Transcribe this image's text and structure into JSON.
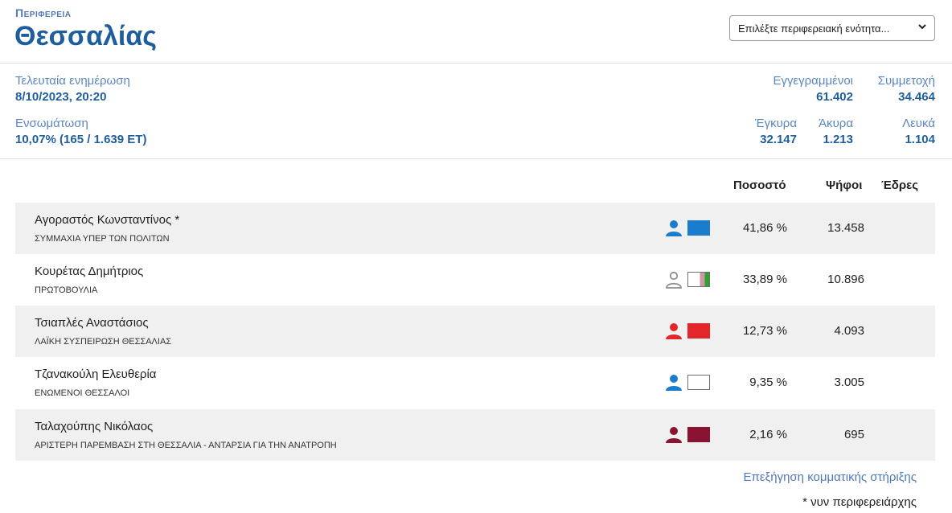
{
  "header": {
    "kicker": "Περιφερεια",
    "title": "Θεσσαλίας",
    "select_label": "Επιλέξτε περιφερειακή ενότητα..."
  },
  "stats": {
    "last_update_label": "Τελευταία ενημέρωση",
    "last_update_value": "8/10/2023, 20:20",
    "integration_label": "Ενσωμάτωση",
    "integration_value": "10,07% (165 / 1.639 ΕΤ)",
    "registered_label": "Εγγεγραμμένοι",
    "registered_value": "61.402",
    "turnout_label": "Συμμετοχή",
    "turnout_value": "34.464",
    "valid_label": "Έγκυρα",
    "valid_value": "32.147",
    "invalid_label": "Άκυρα",
    "invalid_value": "1.213",
    "blank_label": "Λευκά",
    "blank_value": "1.104"
  },
  "table": {
    "headers": {
      "percent": "Ποσοστό",
      "votes": "Ψήφοι",
      "seats": "Έδρες"
    },
    "rows": [
      {
        "name": "Αγοραστός Κωνσταντίνος *",
        "party": "ΣΥΜΜΑΧΙΑ ΥΠΕΡ ΤΩΝ ΠΟΛΙΤΩΝ",
        "percent": "41,86 %",
        "votes": "13.458",
        "color": "#1a7ccc",
        "icon": "person-filled-icon"
      },
      {
        "name": "Κουρέτας Δημήτριος",
        "party": "ΠΡΩΤΟΒΟΥΛΙΑ",
        "percent": "33,89 %",
        "votes": "10.896",
        "color": "#8f8f8f",
        "icon": "person-outline-icon"
      },
      {
        "name": "Τσιαπλές Αναστάσιος",
        "party": "ΛΑΪΚΗ ΣΥΣΠΕΙΡΩΣΗ ΘΕΣΣΑΛΙΑΣ",
        "percent": "12,73 %",
        "votes": "4.093",
        "color": "#e3262a",
        "icon": "person-filled-icon"
      },
      {
        "name": "Τζανακούλη Ελευθερία",
        "party": "ΕΝΩΜΕΝΟΙ ΘΕΣΣΑΛΟΙ",
        "percent": "9,35 %",
        "votes": "3.005",
        "color": "#1a7ccc",
        "icon": "person-filled-icon"
      },
      {
        "name": "Ταλαχούπης Νικόλαος",
        "party": "ΑΡΙΣΤΕΡΗ ΠΑΡΕΜΒΑΣΗ ΣΤΗ ΘΕΣΣΑΛΙΑ - ΑΝΤΑΡΣΙΑ ΓΙΑ ΤΗΝ ΑΝΑΤΡΟΠΗ",
        "percent": "2,16 %",
        "votes": "695",
        "color": "#8b1332",
        "icon": "person-filled-icon"
      }
    ]
  },
  "footer": {
    "link": "Επεξήγηση κομματικής στήριξης",
    "note": "* νυν περιφερειάρχης"
  }
}
